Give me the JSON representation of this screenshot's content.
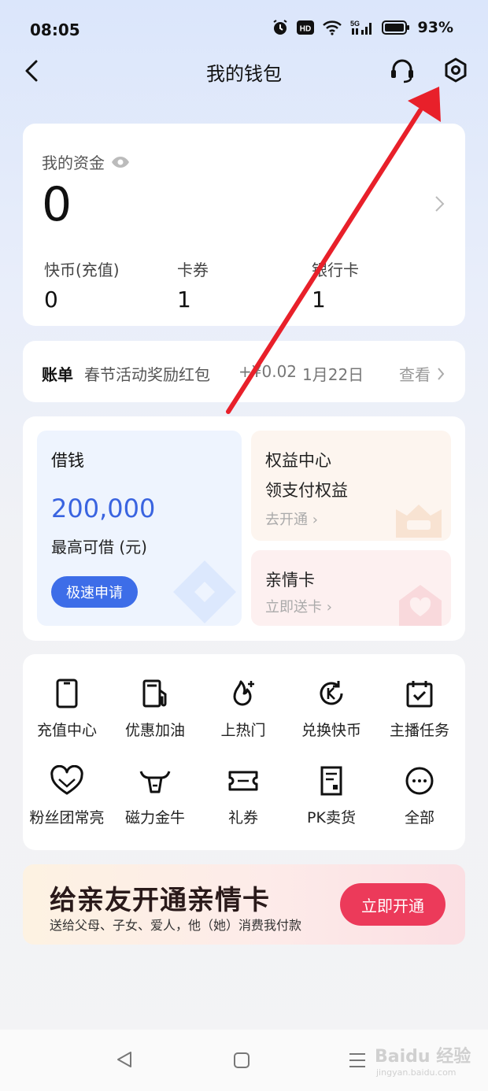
{
  "status_bar": {
    "time": "08:05",
    "battery": "93%"
  },
  "nav": {
    "title": "我的钱包"
  },
  "funds": {
    "label": "我的资金",
    "value": "0",
    "stats": [
      {
        "label": "快币(充值)",
        "value": "0"
      },
      {
        "label": "卡券",
        "value": "1"
      },
      {
        "label": "银行卡",
        "value": "1"
      }
    ]
  },
  "bill": {
    "label": "账单",
    "description": "春节活动奖励红包",
    "amount": "+¥0.02",
    "date": "1月22日",
    "view": "查看"
  },
  "loan": {
    "title": "借钱",
    "amount": "200,000",
    "description": "最高可借 (元)",
    "button": "极速申请"
  },
  "rights": {
    "title": "权益中心",
    "subtitle": "领支付权益",
    "link": "去开通"
  },
  "family_card": {
    "title": "亲情卡",
    "link": "立即送卡"
  },
  "grid": [
    {
      "label": "充值中心",
      "icon": "phone-icon"
    },
    {
      "label": "优惠加油",
      "icon": "fuel-icon"
    },
    {
      "label": "上热门",
      "icon": "flame-icon"
    },
    {
      "label": "兑换快币",
      "icon": "exchange-icon"
    },
    {
      "label": "主播任务",
      "icon": "calendar-check-icon"
    },
    {
      "label": "粉丝团常亮",
      "icon": "heart-icon"
    },
    {
      "label": "磁力金牛",
      "icon": "bull-icon"
    },
    {
      "label": "礼券",
      "icon": "ticket-icon"
    },
    {
      "label": "PK卖货",
      "icon": "document-icon"
    },
    {
      "label": "全部",
      "icon": "more-icon"
    }
  ],
  "banner": {
    "title": "给亲友开通亲情卡",
    "subtitle": "送给父母、子女、爱人，他（她）消费我付款",
    "button": "立即开通"
  },
  "watermark": {
    "main": "Baidu 经验",
    "sub": "jingyan.baidu.com"
  },
  "colors": {
    "accent_blue": "#3d6de8",
    "banner_button": "#ec3a5a",
    "annotation_arrow": "#e8202a"
  }
}
